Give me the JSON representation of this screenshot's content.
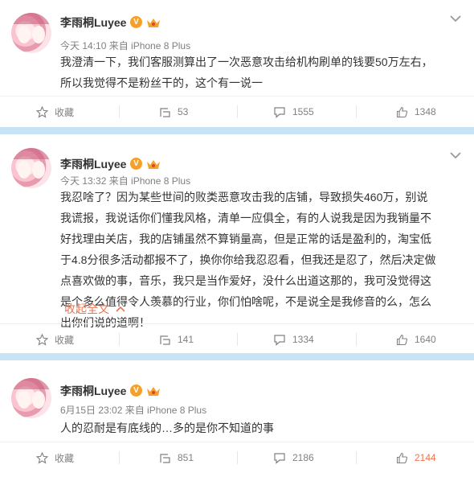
{
  "colors": {
    "separator": "#c8e3f3",
    "link": "#eb7350",
    "meta": "#808080",
    "badge": "#f4a02a"
  },
  "posts": [
    {
      "author": "李雨桐Luyee",
      "badge": "V",
      "meta": "今天 14:10 来自 iPhone 8 Plus",
      "text": "我澄清一下，我们客服测算出了一次恶意攻击给机构刷单的钱要50万左右，所以我觉得不是粉丝干的，这个有一说一",
      "actions": {
        "favorite": "收藏",
        "repost": "53",
        "comment": "1555",
        "like": "1348"
      }
    },
    {
      "author": "李雨桐Luyee",
      "badge": "V",
      "meta": "今天 13:32 来自 iPhone 8 Plus",
      "text": "我忍啥了？因为某些世间的败类恶意攻击我的店铺，导致损失460万，别说我谎报，我说话你们懂我风格，清单一应俱全，有的人说我是因为我销量不好找理由关店，我的店铺虽然不算销量高，但是正常的话是盈利的，淘宝低于4.8分很多活动都报不了，换你你给我忍忍看，但我还是忍了，然后决定做点喜欢做的事，音乐，我只是当作爱好，没什么出道这那的，我可没觉得这是个多么值得令人羡慕的行业，你们怕啥呢，不是说全是我修音的么，怎么出你们说的道啊！",
      "collapse": "收起全文",
      "actions": {
        "favorite": "收藏",
        "repost": "141",
        "comment": "1334",
        "like": "1640"
      }
    },
    {
      "author": "李雨桐Luyee",
      "badge": "V",
      "meta": "6月15日 23:02 来自 iPhone 8 Plus",
      "text": "人的忍耐是有底线的…多的是你不知道的事",
      "actions": {
        "favorite": "收藏",
        "repost": "851",
        "comment": "2186",
        "like": "2144"
      }
    }
  ]
}
